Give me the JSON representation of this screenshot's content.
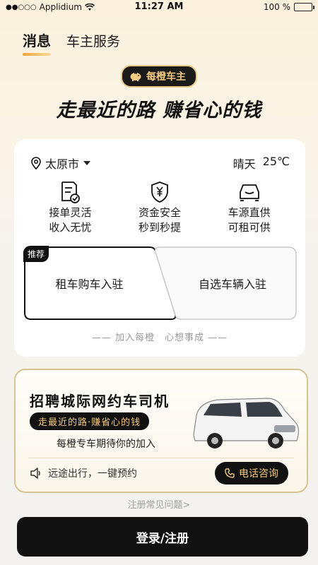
{
  "status_bar": {
    "carrier": "Applidium",
    "time": "11:27 AM",
    "battery": "100 %"
  },
  "tabs": [
    {
      "label": "消息",
      "active": true
    },
    {
      "label": "车主服务",
      "active": false
    }
  ],
  "brand": {
    "badge_label": "每橙车主"
  },
  "headline": "走最近的路 赚省心的钱",
  "location": {
    "city": "太原市"
  },
  "weather": {
    "condition": "晴天",
    "temp": "25℃"
  },
  "features": [
    {
      "icon": "document-check-icon",
      "line1": "接单灵活",
      "line2": "收入无忧"
    },
    {
      "icon": "yuan-shield-icon",
      "line1": "资金安全",
      "line2": "秒到秒提"
    },
    {
      "icon": "car-icon",
      "line1": "车源直供",
      "line2": "可租可供"
    }
  ],
  "options": {
    "recommend_tag": "推荐",
    "rent_buy": "租车购车入驻",
    "own_car": "自选车辆入驻"
  },
  "join_text": "—— 加入每橙　心想事成 ——",
  "recruit": {
    "title": "招聘城际网约车司机",
    "slogan": "走最近的路·赚省心的钱",
    "subtitle": "每橙专车期待你的加入",
    "booking": "远途出行，一键预约",
    "call_button": "电话咨询"
  },
  "faq_link": "注册常见问题>",
  "login_button": "登录/注册",
  "colors": {
    "accent_gold": "#f2c77a",
    "dark": "#111111"
  }
}
